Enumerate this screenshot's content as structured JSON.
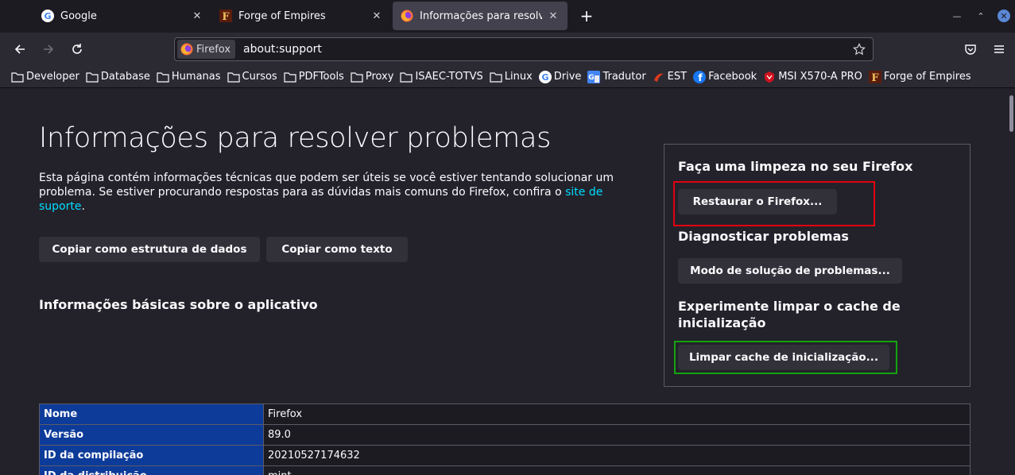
{
  "tabs": [
    {
      "title": "Google",
      "icon": "google-icon"
    },
    {
      "title": "Forge of Empires",
      "icon": "forge-of-empires-icon"
    },
    {
      "title": "Informações para resolver p",
      "icon": "firefox-icon",
      "active": true
    }
  ],
  "navbar": {
    "identity_label": "Firefox",
    "url": "about:support"
  },
  "bookmarks": [
    {
      "label": "Developer",
      "icon": "folder-icon"
    },
    {
      "label": "Database",
      "icon": "folder-icon"
    },
    {
      "label": "Humanas",
      "icon": "folder-icon"
    },
    {
      "label": "Cursos",
      "icon": "folder-icon"
    },
    {
      "label": "PDFTools",
      "icon": "folder-icon"
    },
    {
      "label": "Proxy",
      "icon": "folder-icon"
    },
    {
      "label": "ISAEC-TOTVS",
      "icon": "folder-icon"
    },
    {
      "label": "Linux",
      "icon": "folder-icon"
    },
    {
      "label": "Drive",
      "icon": "google-icon"
    },
    {
      "label": "Tradutor",
      "icon": "translate-icon"
    },
    {
      "label": "EST",
      "icon": "est-icon"
    },
    {
      "label": "Facebook",
      "icon": "facebook-icon"
    },
    {
      "label": "MSI X570-A PRO",
      "icon": "msi-icon"
    },
    {
      "label": "Forge of Empires",
      "icon": "forge-of-empires-icon"
    }
  ],
  "page": {
    "title": "Informações para resolver problemas",
    "intro_text": "Esta página contém informações técnicas que podem ser úteis se você estiver tentando solucionar um problema. Se estiver procurando respostas para as dúvidas mais comuns do Firefox, confira o ",
    "intro_link": "site de suporte",
    "intro_end": ".",
    "copy_raw_button": "Copiar como estrutura de dados",
    "copy_text_button": "Copiar como texto",
    "section_title": "Informações básicas sobre o aplicativo"
  },
  "sidebox": {
    "refresh_heading": "Faça uma limpeza no seu Firefox",
    "refresh_button": "Restaurar o Firefox...",
    "diagnose_heading": "Diagnosticar problemas",
    "troubleshoot_button": "Modo de solução de problemas...",
    "cache_heading": "Experimente limpar o cache de inicialização",
    "cache_button": "Limpar cache de inicialização..."
  },
  "app_info": [
    {
      "key": "Nome",
      "value": "Firefox"
    },
    {
      "key": "Versão",
      "value": "89.0"
    },
    {
      "key": "ID da compilação",
      "value": "20210527174632"
    },
    {
      "key": "ID da distribuição",
      "value": "mint"
    }
  ],
  "colors": {
    "link": "#00ddff",
    "table_key_bg": "#0d3b99",
    "highlight_red": "#e3000e",
    "highlight_green": "#14a30e"
  }
}
